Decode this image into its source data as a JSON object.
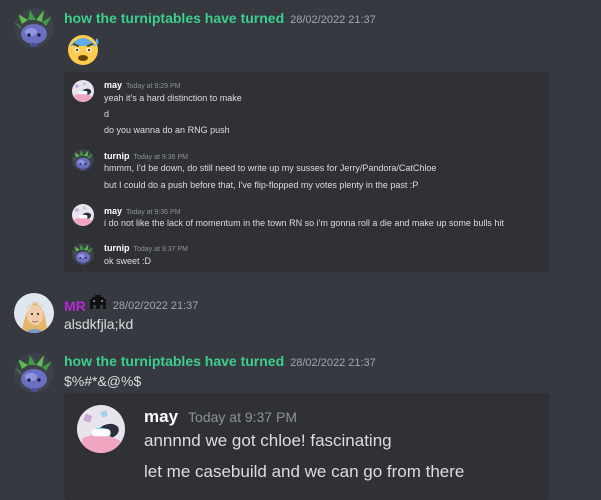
{
  "colors": {
    "background": "#36393f",
    "quote_bg": "#2f3136",
    "turnip_name": "#3ccf8e",
    "mr_name": "#b52bd6",
    "body_text": "#dcddde",
    "timestamp": "#a3a6aa"
  },
  "messages": [
    {
      "author": "how the turniptables have turned",
      "timestamp": "28/02/2022 21:37",
      "avatar_icon": "turnip-avatar-icon",
      "content_emoji": "anxious-sweat-emoji-icon",
      "quote": [
        {
          "author": "may",
          "timestamp": "Today at 9:29 PM",
          "avatar_icon": "may-avatar-icon",
          "lines": [
            "yeah it's a hard distinction to make",
            "d",
            "do you wanna do an RNG push"
          ]
        },
        {
          "author": "turnip",
          "timestamp": "Today at 9:36 PM",
          "avatar_icon": "turnip-avatar-icon",
          "lines": [
            "hmmm, I'd be down, do still need to write up my susses for Jerry/Pandora/CatChloe",
            "but I could do a push before that, I've flip-flopped my votes plenty in the past :P"
          ]
        },
        {
          "author": "may",
          "timestamp": "Today at 9:36 PM",
          "avatar_icon": "may-avatar-icon",
          "lines": [
            "i do not like the lack of momentum in the town RN so i'm gonna roll a die and make up some bulls hit"
          ]
        },
        {
          "author": "turnip",
          "timestamp": "Today at 9:37 PM",
          "avatar_icon": "turnip-avatar-icon",
          "lines": [
            "ok sweet :D"
          ]
        }
      ]
    },
    {
      "author": "MR",
      "author_badge_icon": "pixel-creature-icon",
      "timestamp": "28/02/2022 21:37",
      "avatar_icon": "portrait-avatar-icon",
      "text": "alsdkfjla;kd"
    },
    {
      "author": "how the turniptables have turned",
      "timestamp": "28/02/2022 21:37",
      "avatar_icon": "turnip-avatar-icon",
      "text": "$%#*&@%$",
      "quote": [
        {
          "author": "may",
          "timestamp": "Today at 9:37 PM",
          "avatar_icon": "may-avatar-icon",
          "lines": [
            "annnnd we got chloe! fascinating",
            "let me casebuild and we can go from there"
          ]
        }
      ]
    }
  ]
}
